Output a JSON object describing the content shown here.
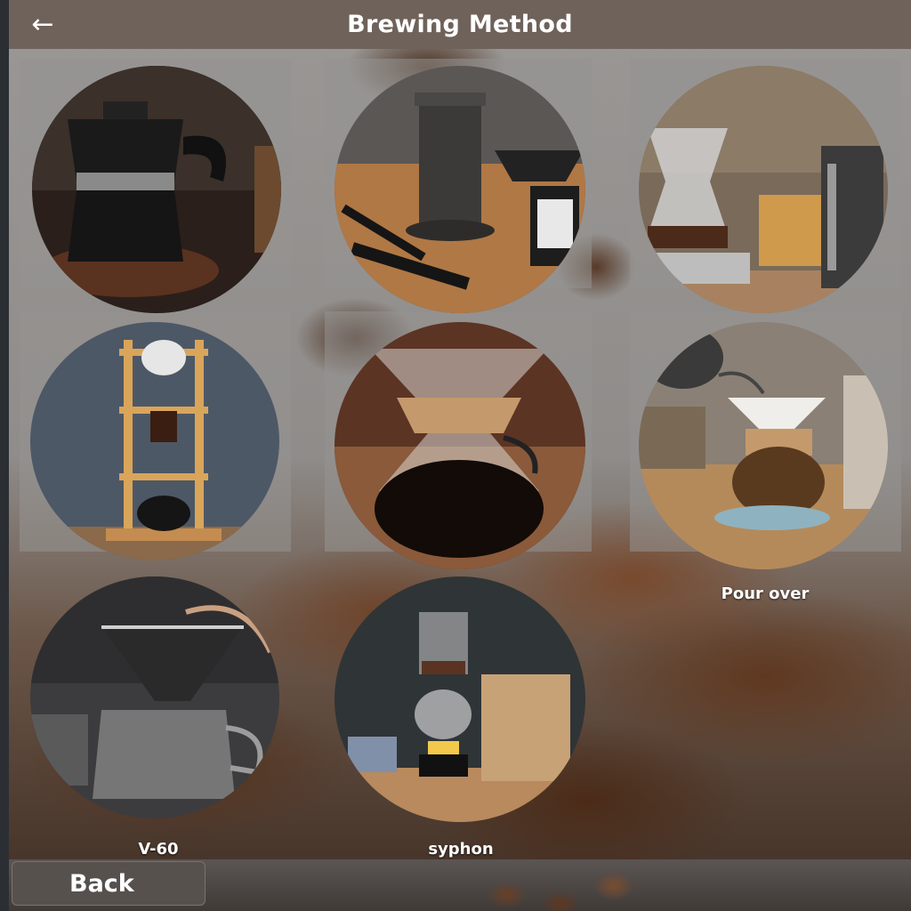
{
  "header": {
    "title": "Brewing Method",
    "back_icon": "arrow-left-icon",
    "back_glyph": "🡐"
  },
  "methods": [
    {
      "name": "moka pot",
      "label": ""
    },
    {
      "name": "aeropress",
      "label": ""
    },
    {
      "name": "cold drip tower",
      "label": ""
    },
    {
      "name": "ice drip",
      "label": ""
    },
    {
      "name": "chemex",
      "label": ""
    },
    {
      "name": "pour over",
      "label": "Pour over"
    },
    {
      "name": "v60",
      "label": "V-60"
    },
    {
      "name": "syphon",
      "label": "syphon"
    }
  ],
  "footer": {
    "back_label": "Back"
  },
  "colors": {
    "header_bg": "#6e625b",
    "header_text": "#ffffff",
    "back_button_bg": "#57514e"
  }
}
